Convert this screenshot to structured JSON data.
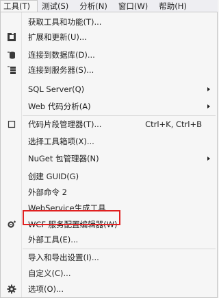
{
  "menubar": {
    "items": [
      "工具(T)",
      "测试(S)",
      "分析(N)",
      "窗口(W)",
      "帮助(H)"
    ]
  },
  "menu": {
    "items": [
      {
        "label": "获取工具和功能(T)..."
      },
      {
        "label": "扩展和更新(U)..."
      },
      {
        "label": "连接到数据库(D)..."
      },
      {
        "label": "连接到服务器(S)..."
      },
      {
        "label": "SQL Server(Q)"
      },
      {
        "label": "Web 代码分析(A)"
      },
      {
        "label": "代码片段管理器(T)...",
        "shortcut": "Ctrl+K, Ctrl+B"
      },
      {
        "label": "选择工具箱项(X)..."
      },
      {
        "label": "NuGet 包管理器(N)"
      },
      {
        "label": "创建 GUID(G)"
      },
      {
        "label": "外部命令 2"
      },
      {
        "label": "WebService生成工具"
      },
      {
        "label": "WCF 服务配置编辑器(W)"
      },
      {
        "label": "外部工具(E)..."
      },
      {
        "label": "导入和导出设置(I)..."
      },
      {
        "label": "自定义(C)..."
      },
      {
        "label": "选项(O)..."
      }
    ]
  },
  "icons": {
    "extensions": "extensions-icon",
    "database": "connect-database-icon",
    "server": "connect-server-icon",
    "snippet": "snippet-manager-icon",
    "wcf": "wcf-config-icon",
    "options": "gear-icon"
  },
  "colors": {
    "highlight_border": "#e02020",
    "menu_background": "#f6f6f6",
    "menubar_background": "#eeeef2"
  }
}
